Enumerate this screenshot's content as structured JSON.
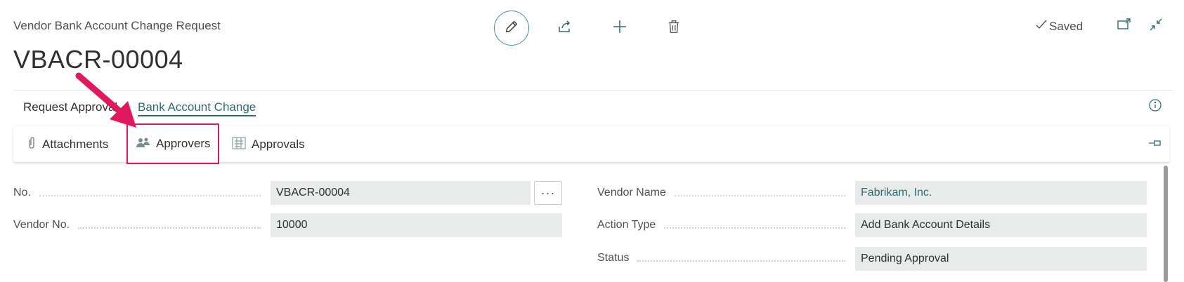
{
  "header": {
    "caption": "Vendor Bank Account Change Request",
    "title": "VBACR-00004",
    "saved_label": "Saved"
  },
  "toolbar": {
    "icons": [
      "edit-icon",
      "share-icon",
      "new-icon",
      "delete-icon",
      "open-new-window-icon",
      "collapse-icon"
    ]
  },
  "action_tabs": {
    "request_approval": "Request Approval",
    "bank_account_change": "Bank Account Change"
  },
  "promoted_actions": [
    {
      "label": "Attachments",
      "icon": "paperclip-icon"
    },
    {
      "label": "Approvers",
      "icon": "people-icon"
    },
    {
      "label": "Approvals",
      "icon": "approvals-icon"
    }
  ],
  "form": {
    "left": [
      {
        "label": "No.",
        "value": "VBACR-00004"
      },
      {
        "label": "Vendor No.",
        "value": "10000"
      }
    ],
    "right": [
      {
        "label": "Vendor Name",
        "value": "Fabrikam, Inc."
      },
      {
        "label": "Action Type",
        "value": "Add Bank Account Details"
      },
      {
        "label": "Status",
        "value": "Pending Approval"
      }
    ],
    "lookup_label": "···"
  },
  "colors": {
    "accent": "#2a6e73",
    "highlight": "#d81b60",
    "field_bg": "#e9ebeb"
  }
}
